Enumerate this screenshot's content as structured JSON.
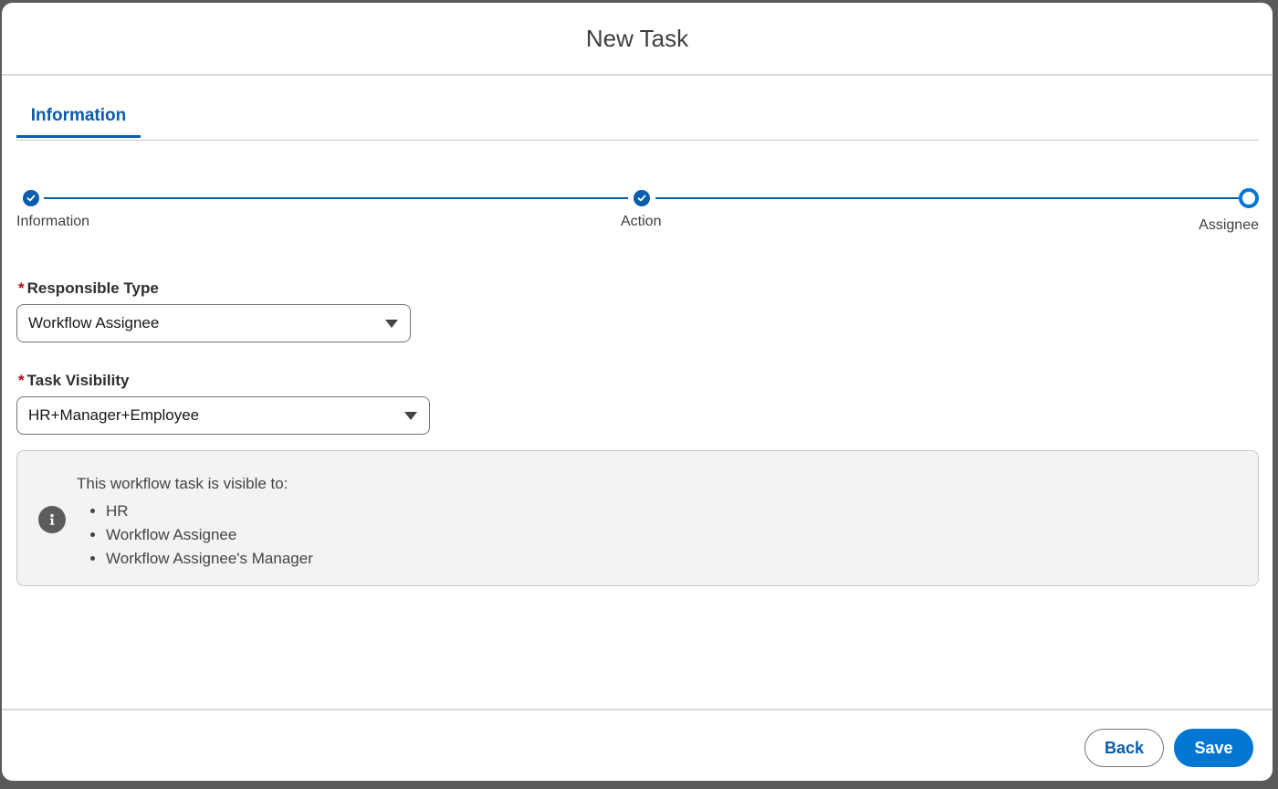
{
  "modal": {
    "title": "New Task"
  },
  "tabs": [
    {
      "label": "Information",
      "active": true
    }
  ],
  "progress": {
    "steps": [
      {
        "label": "Information",
        "state": "complete"
      },
      {
        "label": "Action",
        "state": "complete"
      },
      {
        "label": "Assignee",
        "state": "current"
      }
    ],
    "accent_color": "#0b5cab"
  },
  "form": {
    "responsible_type": {
      "label": "Responsible Type",
      "required_marker": "*",
      "value": "Workflow Assignee"
    },
    "task_visibility": {
      "label": "Task Visibility",
      "required_marker": "*",
      "value": "HR+Manager+Employee"
    }
  },
  "info": {
    "icon": "info-icon",
    "intro": "This workflow task is visible to:",
    "items": [
      "HR",
      "Workflow Assignee",
      "Workflow Assignee's Manager"
    ]
  },
  "footer": {
    "back_label": "Back",
    "save_label": "Save",
    "primary_color": "#0176d3"
  }
}
